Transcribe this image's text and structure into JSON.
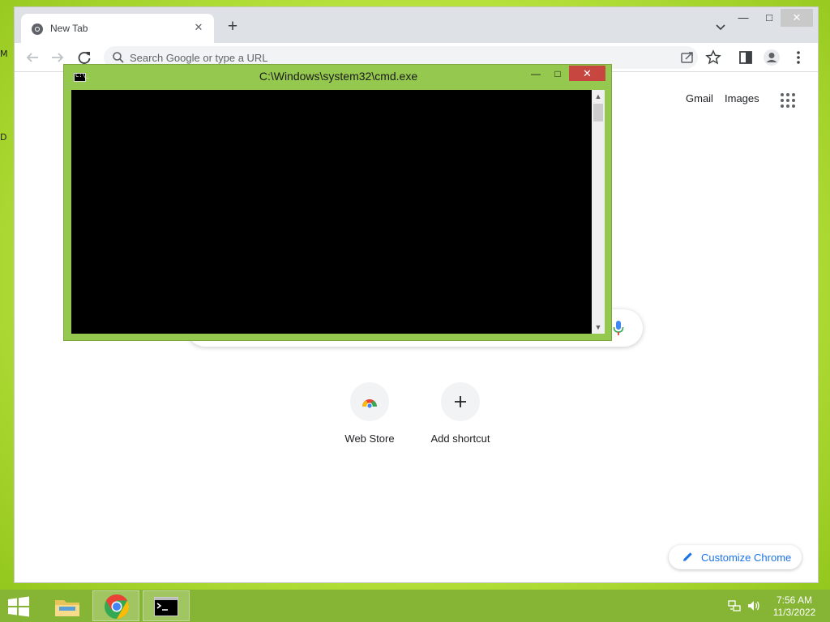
{
  "desktop": {
    "glyph_1": "M",
    "glyph_2": "D"
  },
  "chrome": {
    "tab": {
      "title": "New Tab"
    },
    "window_buttons": {
      "minimize": "—",
      "maximize": "□",
      "close": "✕"
    },
    "omnibox": {
      "placeholder": "Search Google or type a URL"
    },
    "page": {
      "links": {
        "gmail": "Gmail",
        "images": "Images"
      },
      "shortcuts": [
        {
          "label": "Web Store",
          "icon": "web-store-icon"
        },
        {
          "label": "Add shortcut",
          "icon": "plus-icon"
        }
      ],
      "customize_label": "Customize Chrome"
    }
  },
  "cmd": {
    "title": "C:\\Windows\\system32\\cmd.exe",
    "icon_text": "C:\\_",
    "buttons": {
      "minimize": "—",
      "maximize": "□",
      "close": "✕"
    }
  },
  "taskbar": {
    "apps": [
      "file-explorer",
      "google-chrome",
      "command-prompt"
    ],
    "clock": {
      "time": "7:56 AM",
      "date": "11/3/2022"
    }
  },
  "colors": {
    "accent": "#1a73e8",
    "cmd_frame": "#95c84f",
    "cmd_close": "#c7463f",
    "taskbar": "#86b535"
  }
}
